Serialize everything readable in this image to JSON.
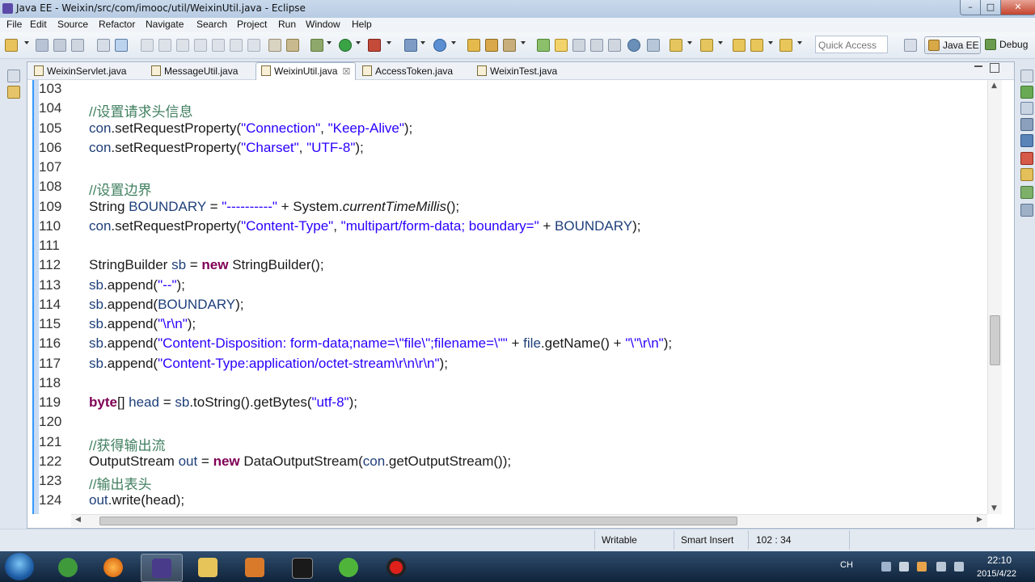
{
  "window": {
    "title": "Java EE - Weixin/src/com/imooc/util/WeixinUtil.java - Eclipse",
    "min_glyph": "–",
    "max_glyph": "□",
    "close_glyph": "✕"
  },
  "menu": [
    "File",
    "Edit",
    "Source",
    "Refactor",
    "Navigate",
    "Search",
    "Project",
    "Run",
    "Window",
    "Help"
  ],
  "toolbar": {
    "quick_access_placeholder": "Quick Access",
    "perspectives": {
      "javaee": "Java EE",
      "debug": "Debug"
    }
  },
  "tabs": [
    {
      "label": "WeixinServlet.java",
      "active": false
    },
    {
      "label": "MessageUtil.java",
      "active": false
    },
    {
      "label": "WeixinUtil.java",
      "active": true
    },
    {
      "label": "AccessToken.java",
      "active": false
    },
    {
      "label": "WeixinTest.java",
      "active": false
    }
  ],
  "tab_close_glyph": "☒",
  "editor": {
    "lines": [
      {
        "n": "103",
        "tokens": []
      },
      {
        "n": "104",
        "tokens": [
          [
            "//设置请求头信息",
            "com"
          ]
        ]
      },
      {
        "n": "105",
        "tokens": [
          [
            "con",
            "var"
          ],
          [
            ".setRequestProperty(",
            "plain"
          ],
          [
            "\"Connection\"",
            "str"
          ],
          [
            ", ",
            "plain"
          ],
          [
            "\"Keep-Alive\"",
            "str"
          ],
          [
            ");",
            "plain"
          ]
        ]
      },
      {
        "n": "106",
        "tokens": [
          [
            "con",
            "var"
          ],
          [
            ".setRequestProperty(",
            "plain"
          ],
          [
            "\"Charset\"",
            "str"
          ],
          [
            ", ",
            "plain"
          ],
          [
            "\"UTF-8\"",
            "str"
          ],
          [
            ");",
            "plain"
          ]
        ]
      },
      {
        "n": "107",
        "tokens": []
      },
      {
        "n": "108",
        "tokens": [
          [
            "//设置边界",
            "com"
          ]
        ]
      },
      {
        "n": "109",
        "tokens": [
          [
            "String ",
            "plain"
          ],
          [
            "BOUNDARY",
            "var"
          ],
          [
            " = ",
            "plain"
          ],
          [
            "\"----------\"",
            "str"
          ],
          [
            " + System.",
            "plain"
          ],
          [
            "currentTimeMillis",
            "ital"
          ],
          [
            "();",
            "plain"
          ]
        ]
      },
      {
        "n": "110",
        "tokens": [
          [
            "con",
            "var"
          ],
          [
            ".setRequestProperty(",
            "plain"
          ],
          [
            "\"Content-Type\"",
            "str"
          ],
          [
            ", ",
            "plain"
          ],
          [
            "\"multipart/form-data; boundary=\"",
            "str"
          ],
          [
            " + ",
            "plain"
          ],
          [
            "BOUNDARY",
            "var"
          ],
          [
            ");",
            "plain"
          ]
        ]
      },
      {
        "n": "111",
        "tokens": []
      },
      {
        "n": "112",
        "tokens": [
          [
            "StringBuilder ",
            "plain"
          ],
          [
            "sb",
            "var"
          ],
          [
            " = ",
            "plain"
          ],
          [
            "new",
            "kw"
          ],
          [
            " StringBuilder();",
            "plain"
          ]
        ]
      },
      {
        "n": "113",
        "tokens": [
          [
            "sb",
            "var"
          ],
          [
            ".append(",
            "plain"
          ],
          [
            "\"--\"",
            "str"
          ],
          [
            ");",
            "plain"
          ]
        ]
      },
      {
        "n": "114",
        "tokens": [
          [
            "sb",
            "var"
          ],
          [
            ".append(",
            "plain"
          ],
          [
            "BOUNDARY",
            "var"
          ],
          [
            ");",
            "plain"
          ]
        ]
      },
      {
        "n": "115",
        "tokens": [
          [
            "sb",
            "var"
          ],
          [
            ".append(",
            "plain"
          ],
          [
            "\"\\r\\n\"",
            "str"
          ],
          [
            ");",
            "plain"
          ]
        ]
      },
      {
        "n": "116",
        "tokens": [
          [
            "sb",
            "var"
          ],
          [
            ".append(",
            "plain"
          ],
          [
            "\"Content-Disposition: form-data;name=\\\"file\\\";filename=\\\"\"",
            "str"
          ],
          [
            " + ",
            "plain"
          ],
          [
            "file",
            "var"
          ],
          [
            ".getName() + ",
            "plain"
          ],
          [
            "\"\\\"\\r\\n\"",
            "str"
          ],
          [
            ");",
            "plain"
          ]
        ]
      },
      {
        "n": "117",
        "tokens": [
          [
            "sb",
            "var"
          ],
          [
            ".append(",
            "plain"
          ],
          [
            "\"Content-Type:application/octet-stream\\r\\n\\r\\n\"",
            "str"
          ],
          [
            ");",
            "plain"
          ]
        ]
      },
      {
        "n": "118",
        "tokens": []
      },
      {
        "n": "119",
        "tokens": [
          [
            "byte",
            "kw"
          ],
          [
            "[] ",
            "plain"
          ],
          [
            "head",
            "var"
          ],
          [
            " = ",
            "plain"
          ],
          [
            "sb",
            "var"
          ],
          [
            ".toString().getBytes(",
            "plain"
          ],
          [
            "\"utf-8\"",
            "str"
          ],
          [
            ");",
            "plain"
          ]
        ]
      },
      {
        "n": "120",
        "tokens": []
      },
      {
        "n": "121",
        "tokens": [
          [
            "//获得输出流",
            "com"
          ]
        ]
      },
      {
        "n": "122",
        "tokens": [
          [
            "OutputStream ",
            "plain"
          ],
          [
            "out",
            "var"
          ],
          [
            " = ",
            "plain"
          ],
          [
            "new",
            "kw"
          ],
          [
            " DataOutputStream(",
            "plain"
          ],
          [
            "con",
            "var"
          ],
          [
            ".getOutputStream());",
            "plain"
          ]
        ]
      },
      {
        "n": "123",
        "tokens": [
          [
            "//输出表头",
            "com"
          ]
        ]
      },
      {
        "n": "124",
        "tokens": [
          [
            "out",
            "var"
          ],
          [
            ".write(head);",
            "plain"
          ]
        ]
      }
    ]
  },
  "status": {
    "mode": "Writable",
    "insert": "Smart Insert",
    "position": "102 : 34"
  },
  "taskbar": {
    "lang": "CH",
    "time": "22:10",
    "date": "2015/4/22"
  },
  "colors": {
    "accent": "#3399ff",
    "comment": "#3f7f5f",
    "string": "#2a00ff",
    "keyword": "#7f0055",
    "field": "#1e3f7a"
  }
}
